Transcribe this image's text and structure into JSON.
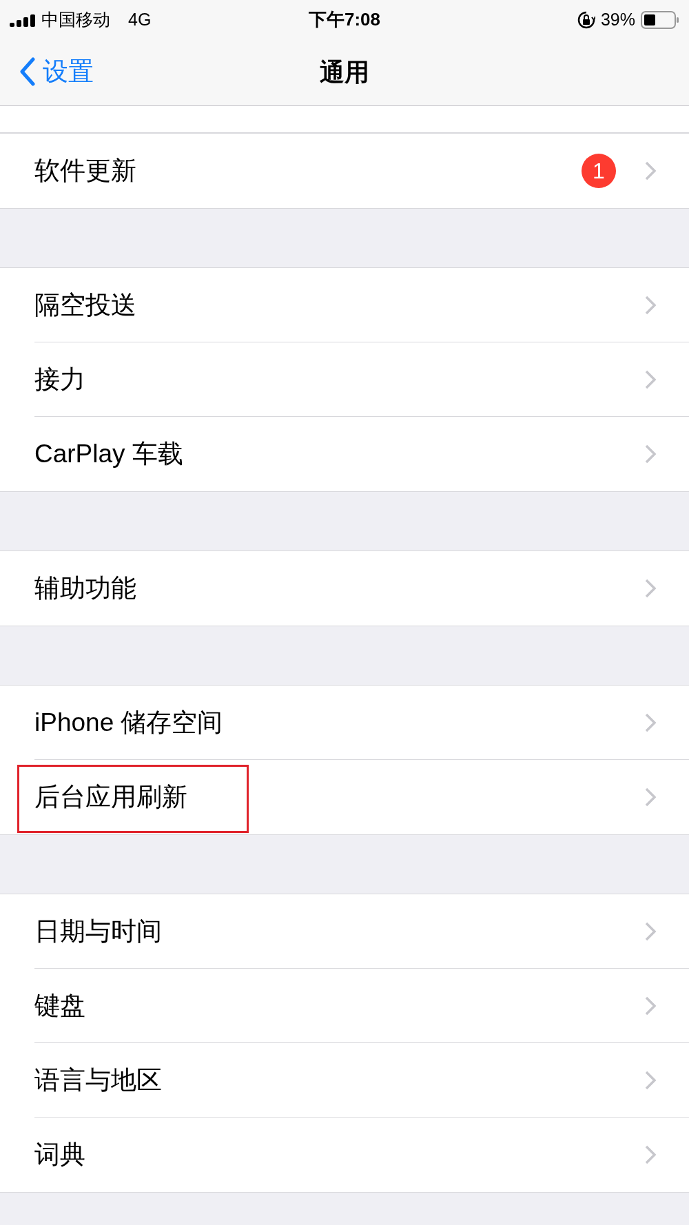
{
  "status_bar": {
    "carrier": "中国移动",
    "network": "4G",
    "time": "下午7:08",
    "battery": "39%"
  },
  "nav": {
    "back": "设置",
    "title": "通用"
  },
  "groups": [
    {
      "items": [
        {
          "label": "软件更新",
          "badge": "1",
          "highlighted": false
        }
      ]
    },
    {
      "items": [
        {
          "label": "隔空投送",
          "highlighted": false
        },
        {
          "label": "接力",
          "highlighted": false
        },
        {
          "label": "CarPlay 车载",
          "highlighted": false
        }
      ]
    },
    {
      "items": [
        {
          "label": "辅助功能",
          "highlighted": false
        }
      ]
    },
    {
      "items": [
        {
          "label": "iPhone 储存空间",
          "highlighted": false
        },
        {
          "label": "后台应用刷新",
          "highlighted": true
        }
      ]
    },
    {
      "items": [
        {
          "label": "日期与时间",
          "highlighted": false
        },
        {
          "label": "键盘",
          "highlighted": false
        },
        {
          "label": "语言与地区",
          "highlighted": false
        },
        {
          "label": "词典",
          "highlighted": false
        }
      ]
    }
  ]
}
